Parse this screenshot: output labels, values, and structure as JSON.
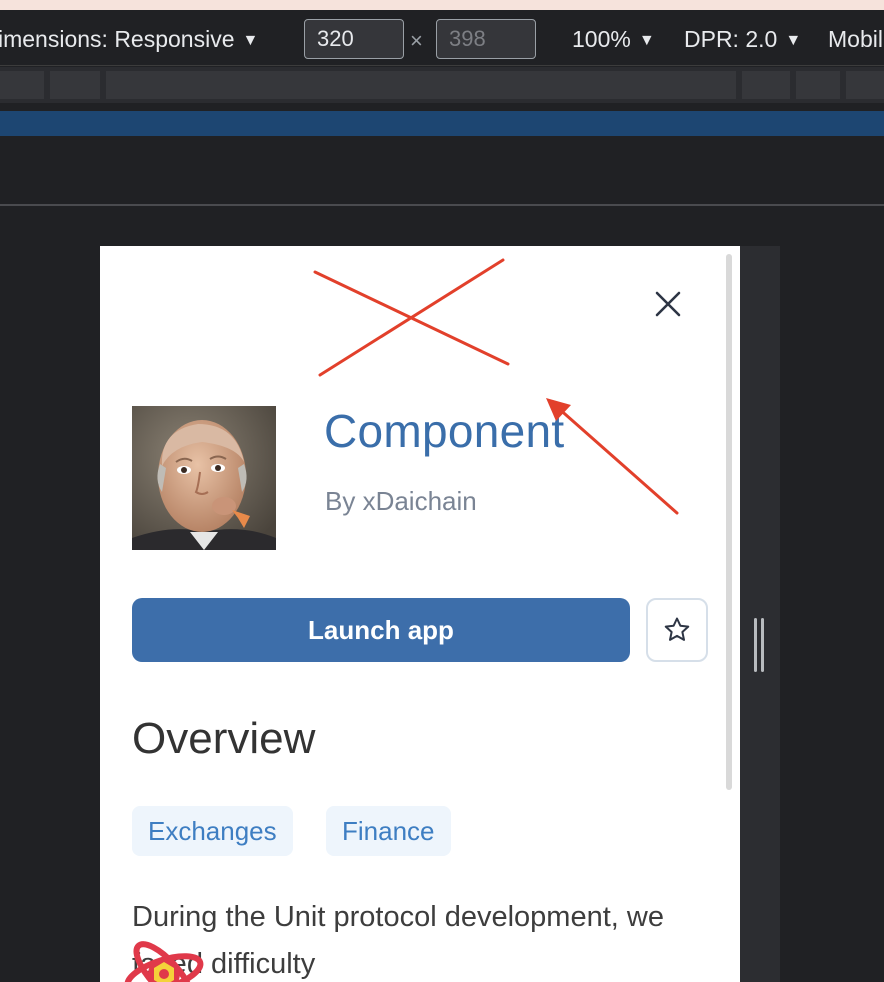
{
  "devtools": {
    "dimensions_label": "imensions: Responsive",
    "width_value": "320",
    "height_placeholder": "398",
    "times_symbol": "×",
    "zoom_label": "100%",
    "dpr_label": "DPR: 2.0",
    "device_label": "Mobil"
  },
  "app": {
    "title": "Component",
    "author": "By xDaichain",
    "launch_label": "Launch app",
    "overview_heading": "Overview",
    "tags": [
      "Exchanges",
      "Finance"
    ],
    "description": "During the Unit protocol development, we faced difficulty"
  },
  "icons": {
    "close": "close-icon",
    "star": "star-icon",
    "caret": "caret-down-icon"
  },
  "colors": {
    "accent": "#3d6eaa",
    "title": "#3a6eaa",
    "tag_bg": "#eef5fc",
    "annotation": "#e2402b"
  }
}
